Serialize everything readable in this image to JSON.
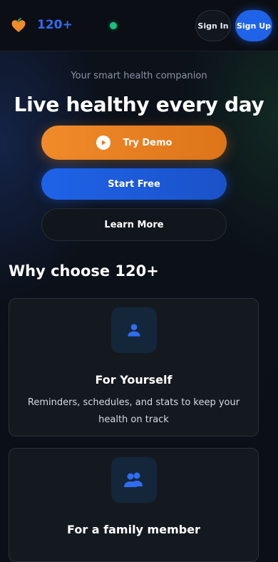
{
  "header": {
    "logo_icon": "heart-icon",
    "brand": "120+",
    "status_color": "#19c27a",
    "sign_in_label": "Sign In",
    "sign_up_label": "Sign Up"
  },
  "hero": {
    "tagline": "Your smart health companion",
    "title": "Live healthy every day",
    "demo_button": {
      "label": "Try Demo",
      "icon": "play-icon"
    },
    "start_button": {
      "label": "Start Free"
    },
    "learn_button": {
      "label": "Learn More"
    }
  },
  "features": {
    "title": "Why choose 120+",
    "cards": [
      {
        "icon": "user-icon",
        "title": "For Yourself",
        "description": "Reminders, schedules, and stats to keep your health on track"
      },
      {
        "icon": "users-icon",
        "title": "For a family member"
      }
    ]
  },
  "colors": {
    "accent_blue": "#1f63e8",
    "accent_orange": "#f08b2a",
    "background": "#0b0f17"
  }
}
